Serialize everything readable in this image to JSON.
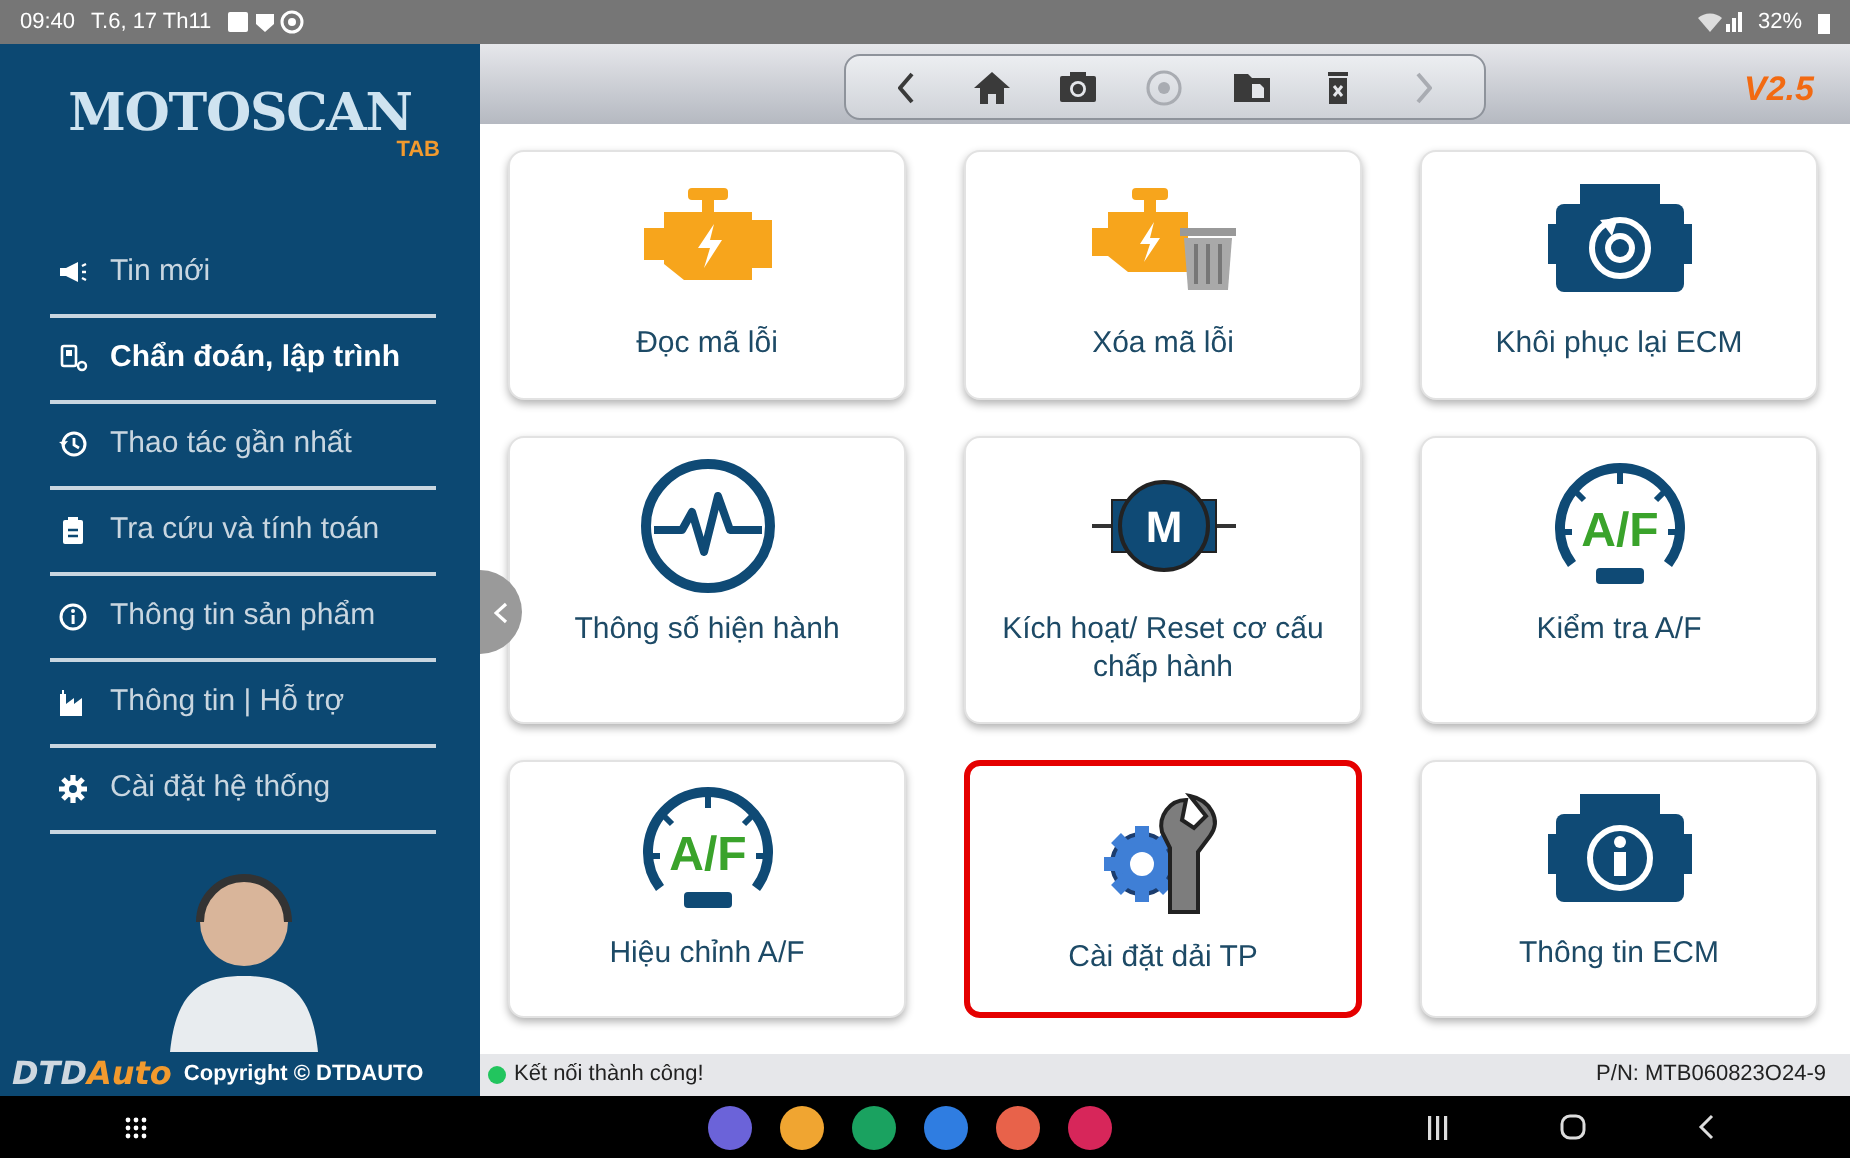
{
  "status_bar": {
    "time": "09:40",
    "date": "T.6, 17 Th11",
    "battery": "32%"
  },
  "sidebar": {
    "logo": "MOTOSCAN",
    "logo_sub": "TAB",
    "items": [
      {
        "label": "Tin mới",
        "kind": "megaphone",
        "selected": false
      },
      {
        "label": "Chẩn đoán, lập trình",
        "kind": "scanner",
        "selected": true
      },
      {
        "label": "Thao tác gần nhất",
        "kind": "history",
        "selected": false
      },
      {
        "label": "Tra cứu và tính toán",
        "kind": "clipboard",
        "selected": false
      },
      {
        "label": "Thông tin sản phẩm",
        "kind": "info",
        "selected": false
      },
      {
        "label": "Thông tin | Hỗ trợ",
        "kind": "factory",
        "selected": false
      },
      {
        "label": "Cài đặt hệ thống",
        "kind": "gear",
        "selected": false
      }
    ],
    "brand_a": "DTD",
    "brand_b": "Auto",
    "copyright": "Copyright © DTDAUTO"
  },
  "toolbar": {
    "buttons": [
      {
        "kind": "back",
        "disabled": false
      },
      {
        "kind": "home",
        "disabled": false
      },
      {
        "kind": "camera",
        "disabled": false
      },
      {
        "kind": "record",
        "disabled": true
      },
      {
        "kind": "file",
        "disabled": false
      },
      {
        "kind": "trash",
        "disabled": false
      },
      {
        "kind": "forward",
        "disabled": true
      }
    ],
    "version": "V2.5"
  },
  "tiles": [
    {
      "label": "Đọc mã lỗi",
      "kind": "engine",
      "selected": false
    },
    {
      "label": "Xóa mã lỗi",
      "kind": "engine-trash",
      "selected": false
    },
    {
      "label": "Khôi phục lại ECM",
      "kind": "ecm-restore",
      "selected": false
    },
    {
      "label": "Thông số hiện hành",
      "kind": "pulse",
      "selected": false
    },
    {
      "label": "Kích hoạt/ Reset cơ cấu chấp hành",
      "kind": "motor",
      "icon_text": "M",
      "selected": false
    },
    {
      "label": "Kiểm tra A/F",
      "kind": "gauge",
      "icon_text": "A/F",
      "selected": false
    },
    {
      "label": "Hiệu chỉnh A/F",
      "kind": "gauge",
      "icon_text": "A/F",
      "selected": false
    },
    {
      "label": "Cài đặt dải TP",
      "kind": "gear-wrench",
      "selected": true
    },
    {
      "label": "Thông tin ECM",
      "kind": "ecm-info",
      "selected": false
    }
  ],
  "connection": {
    "text": "Kết nối thành công!",
    "connected": true
  },
  "part_number": "P/N: MTB060823O24-9",
  "dock": [
    {
      "color": "#6b63d9"
    },
    {
      "color": "#f0a531"
    },
    {
      "color": "#1aa260"
    },
    {
      "color": "#2f7de1"
    },
    {
      "color": "#e8624a"
    },
    {
      "color": "#d7265a"
    }
  ]
}
